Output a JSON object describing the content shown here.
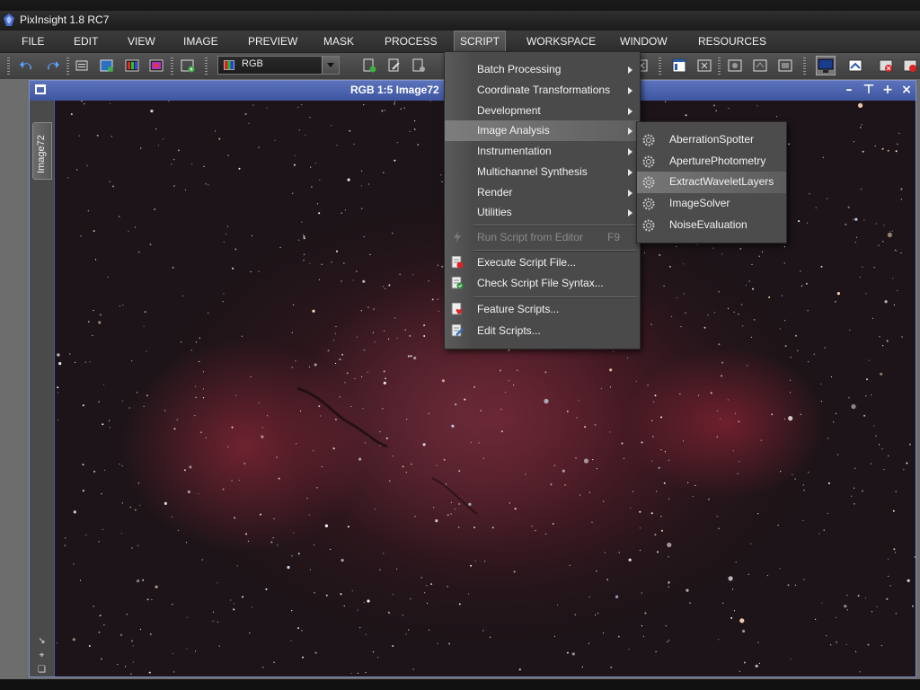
{
  "app": {
    "title": "PixInsight 1.8 RC7"
  },
  "menubar": {
    "items": [
      {
        "label": "FILE"
      },
      {
        "label": "EDIT"
      },
      {
        "label": "VIEW"
      },
      {
        "label": "IMAGE"
      },
      {
        "label": "PREVIEW"
      },
      {
        "label": "MASK"
      },
      {
        "label": "PROCESS"
      },
      {
        "label": "SCRIPT"
      },
      {
        "label": "WORKSPACE"
      },
      {
        "label": "WINDOW"
      },
      {
        "label": "RESOURCES"
      }
    ],
    "active": "SCRIPT"
  },
  "toolbar": {
    "channel_select": {
      "value": "RGB"
    }
  },
  "image_window": {
    "title": "RGB 1:5 Image72",
    "side_tab": "Image72",
    "controls": [
      "minimize-icon",
      "restore-icon",
      "maximize-icon",
      "close-icon"
    ]
  },
  "script_menu": {
    "items": [
      {
        "label": "Batch Processing",
        "submenu": true
      },
      {
        "label": "Coordinate Transformations",
        "submenu": true
      },
      {
        "label": "Development",
        "submenu": true
      },
      {
        "label": "Image Analysis",
        "submenu": true,
        "highlighted": true
      },
      {
        "label": "Instrumentation",
        "submenu": true
      },
      {
        "label": "Multichannel Synthesis",
        "submenu": true
      },
      {
        "label": "Render",
        "submenu": true
      },
      {
        "label": "Utilities",
        "submenu": true
      },
      {
        "label": "Run Script from Editor",
        "shortcut": "F9",
        "disabled": true
      },
      {
        "label": "Execute Script File..."
      },
      {
        "label": "Check Script File Syntax..."
      },
      {
        "label": "Feature Scripts..."
      },
      {
        "label": "Edit Scripts..."
      }
    ]
  },
  "image_analysis_submenu": {
    "items": [
      {
        "label": "AberrationSpotter"
      },
      {
        "label": "AperturePhotometry"
      },
      {
        "label": "ExtractWaveletLayers",
        "highlighted": true
      },
      {
        "label": "ImageSolver"
      },
      {
        "label": "NoiseEvaluation"
      }
    ]
  },
  "colors": {
    "window_title": "#4b62ad",
    "nebula": "#a8344c",
    "menu_bg": "#4a4a4a"
  }
}
